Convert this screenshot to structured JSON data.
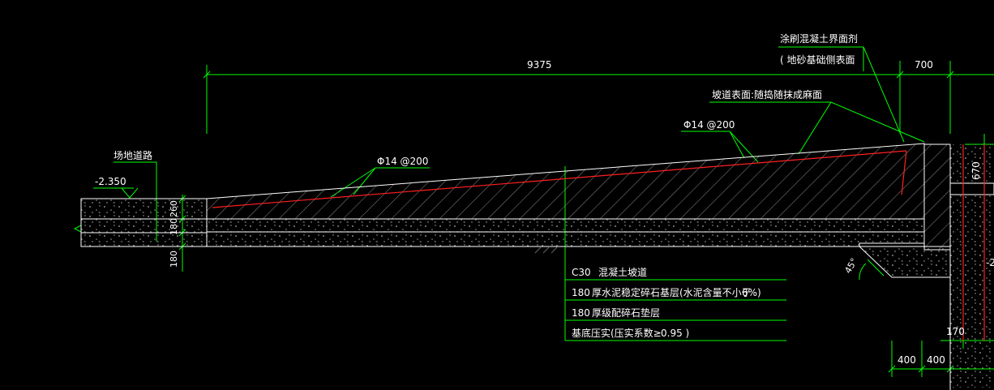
{
  "dimensions": {
    "total_length": "9375",
    "right_width": "700",
    "bar_height": "670",
    "bottom_left": "400",
    "bottom_right": "400",
    "right_small": "170",
    "layer1": "260",
    "layer2": "180",
    "layer3": "180"
  },
  "labels": {
    "road_name": "场地道路",
    "elevation": "-2.350",
    "rebar_left": "Φ14 @200",
    "rebar_right": "Φ14 @200",
    "surface_note": "坡道表面:随捣随抹成麻面",
    "interface_note_1": "涂刷混凝土界面剂",
    "interface_note_2": "( 地砂基础侧表面",
    "angle": "45°",
    "edge_mark": "-2"
  },
  "layer_table": [
    {
      "col1": "C30",
      "col2": "混凝土坡道",
      "col3": ""
    },
    {
      "col1": "180",
      "col2": "厚水泥稳定碎石基层(水泥含量不小于",
      "col3": "6%)"
    },
    {
      "col1": "180",
      "col2": "厚级配碎石垫层",
      "col3": ""
    },
    {
      "col1": "",
      "col2": "基底压实(压实系数≥",
      "col3": "0.95 )"
    }
  ],
  "colors": {
    "background": "#000000",
    "dimension": "#00ff00",
    "outline": "#ffffff",
    "rebar": "#ff2020",
    "hatch": "#909090"
  }
}
